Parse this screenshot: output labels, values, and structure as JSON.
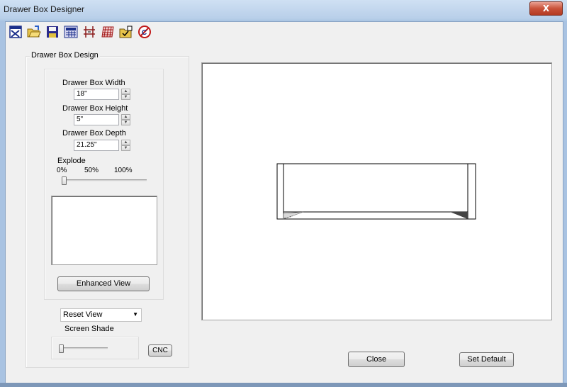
{
  "window": {
    "title": "Drawer Box Designer",
    "close_glyph": "X"
  },
  "toolbar": {
    "icons": [
      "new-icon",
      "open-folder-icon",
      "save-icon",
      "calculator-icon",
      "dimension-icon",
      "grid-icon",
      "export-icon",
      "options-icon"
    ]
  },
  "design_group": {
    "label": "Drawer Box Design",
    "width": {
      "label": "Drawer Box Width",
      "value": "18\""
    },
    "height": {
      "label": "Drawer Box Height",
      "value": "5\""
    },
    "depth": {
      "label": "Drawer Box Depth",
      "value": "21.25\""
    },
    "explode": {
      "label": "Explode",
      "tick_0": "0%",
      "tick_50": "50%",
      "tick_100": "100%",
      "level_percent": 0
    },
    "enhanced_view_label": "Enhanced View"
  },
  "view_select": {
    "value": "Reset View"
  },
  "screen_shade": {
    "label": "Screen Shade",
    "level_percent": 0
  },
  "cnc_label": "CNC",
  "buttons": {
    "close": "Close",
    "set_default": "Set Default"
  },
  "colors": {
    "title_close": "#c9523a",
    "canvas": "#ffffff",
    "dialog": "#f0f0f0"
  }
}
